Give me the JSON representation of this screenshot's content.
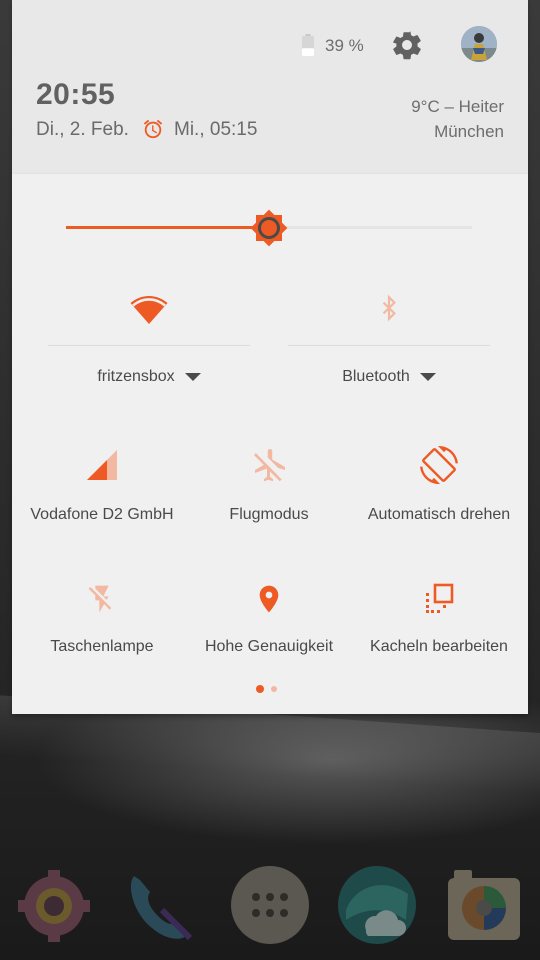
{
  "status": {
    "battery_percent": "39 %",
    "battery_level": 0.39
  },
  "header": {
    "time": "20:55",
    "date": "Di., 2. Feb.",
    "alarm": "Mi., 05:15",
    "weather_line1": "9°C – Heiter",
    "weather_line2": "München"
  },
  "brightness": {
    "level": 0.5
  },
  "tiles": {
    "wifi_label": "fritzensbox",
    "bluetooth_label": "Bluetooth",
    "cellular_label": "Vodafone D2 GmbH",
    "airplane_label": "Flugmodus",
    "rotate_label": "Automatisch drehen",
    "flashlight_label": "Taschenlampe",
    "location_label": "Hohe Genauigkeit",
    "edit_label": "Kacheln bearbeiten"
  },
  "pager": {
    "pages": 2,
    "current": 1
  },
  "colors": {
    "accent": "#ee5a24",
    "accent_inactive": "#f2b8a2",
    "header_bg": "#e8e8e8",
    "panel_bg": "#f0f0f0"
  },
  "dock": {
    "icons": [
      "settings-icon",
      "phone-icon",
      "app-drawer-icon",
      "weather-app-icon",
      "camera-icon"
    ]
  }
}
